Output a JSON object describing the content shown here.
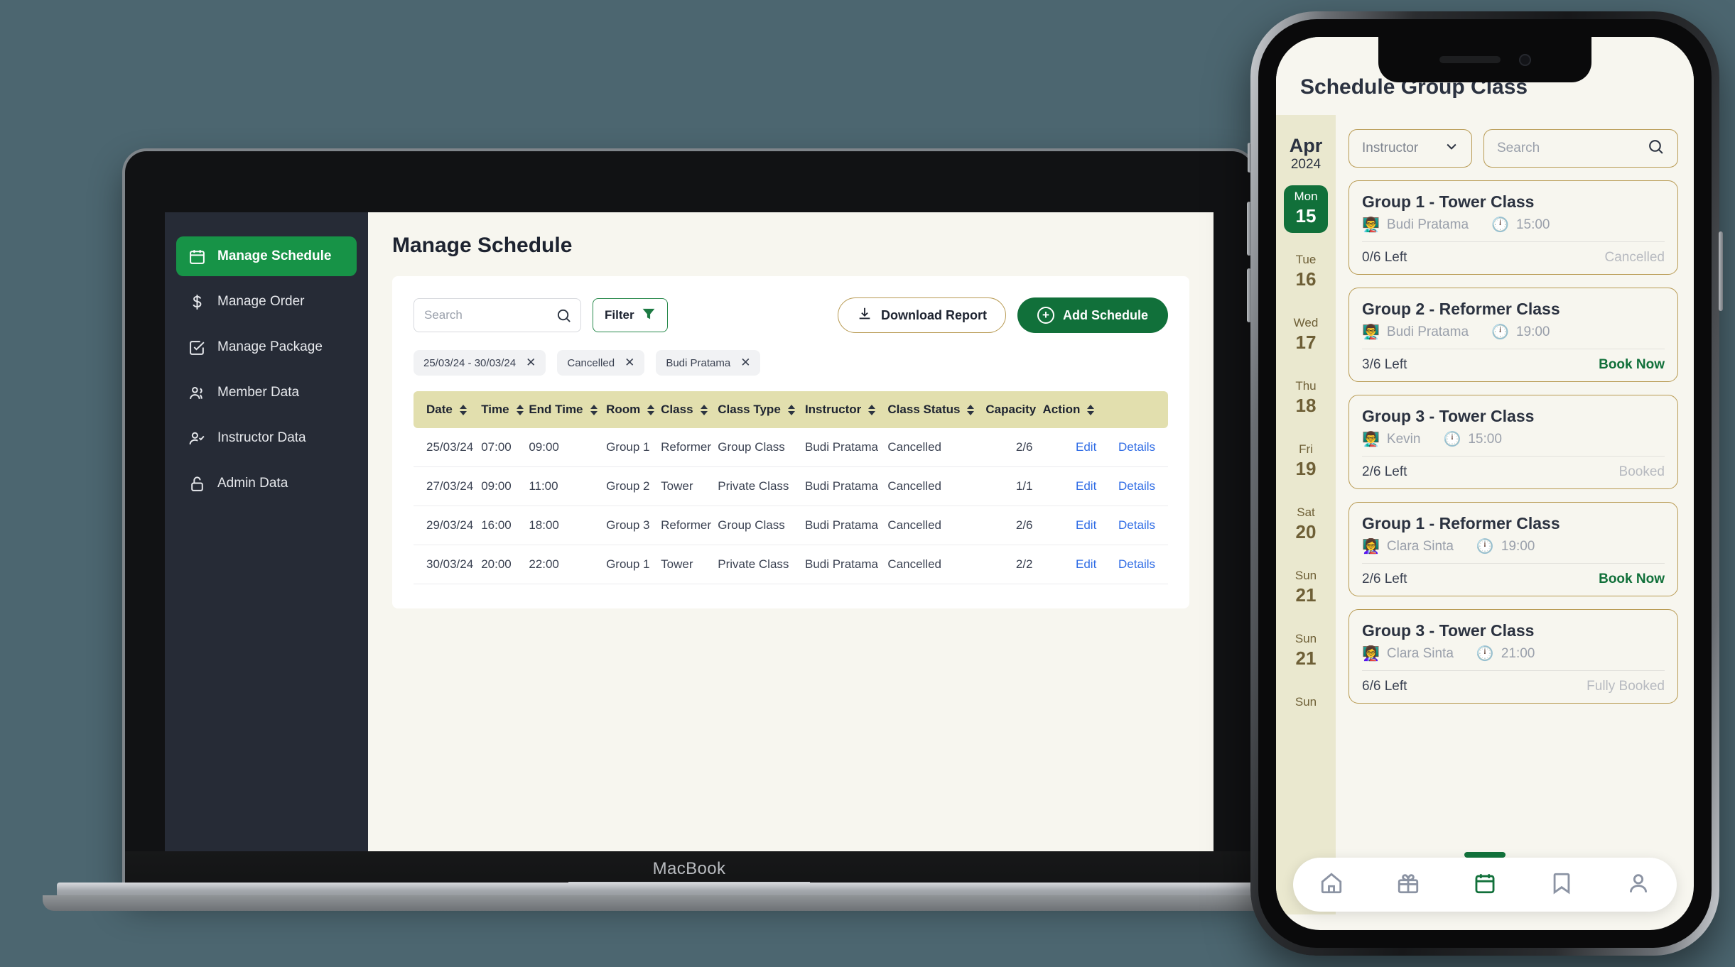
{
  "desktop": {
    "device_label": "MacBook",
    "sidebar": {
      "items": [
        {
          "label": "Manage Schedule",
          "icon": "calendar-icon",
          "active": true
        },
        {
          "label": "Manage Order",
          "icon": "dollar-icon",
          "active": false
        },
        {
          "label": "Manage Package",
          "icon": "checkbox-icon",
          "active": false
        },
        {
          "label": "Member Data",
          "icon": "users-icon",
          "active": false
        },
        {
          "label": "Instructor Data",
          "icon": "user-check-icon",
          "active": false
        },
        {
          "label": "Admin Data",
          "icon": "lock-icon",
          "active": false
        }
      ]
    },
    "page_title": "Manage Schedule",
    "toolbar": {
      "search_placeholder": "Search",
      "filter_label": "Filter",
      "download_label": "Download Report",
      "add_label": "Add Schedule"
    },
    "filter_chips": [
      {
        "label": "25/03/24 - 30/03/24"
      },
      {
        "label": "Cancelled"
      },
      {
        "label": "Budi Pratama"
      }
    ],
    "table": {
      "columns": [
        {
          "label": "Date",
          "sortable": true
        },
        {
          "label": "Time",
          "sortable": true
        },
        {
          "label": "End Time",
          "sortable": true
        },
        {
          "label": "Room",
          "sortable": true
        },
        {
          "label": "Class",
          "sortable": true
        },
        {
          "label": "Class Type",
          "sortable": true
        },
        {
          "label": "Instructor",
          "sortable": true
        },
        {
          "label": "Class Status",
          "sortable": true
        },
        {
          "label": "Capacity",
          "sortable": false
        },
        {
          "label": "Action",
          "sortable": true
        }
      ],
      "rows": [
        {
          "date": "25/03/24",
          "time": "07:00",
          "end_time": "09:00",
          "room": "Group 1",
          "class": "Reformer",
          "class_type": "Group Class",
          "instructor": "Budi Pratama",
          "class_status": "Cancelled",
          "capacity": "2/6",
          "edit": "Edit",
          "details": "Details"
        },
        {
          "date": "27/03/24",
          "time": "09:00",
          "end_time": "11:00",
          "room": "Group 2",
          "class": "Tower",
          "class_type": "Private Class",
          "instructor": "Budi Pratama",
          "class_status": "Cancelled",
          "capacity": "1/1",
          "edit": "Edit",
          "details": "Details"
        },
        {
          "date": "29/03/24",
          "time": "16:00",
          "end_time": "18:00",
          "room": "Group 3",
          "class": "Reformer",
          "class_type": "Group Class",
          "instructor": "Budi Pratama",
          "class_status": "Cancelled",
          "capacity": "2/6",
          "edit": "Edit",
          "details": "Details"
        },
        {
          "date": "30/03/24",
          "time": "20:00",
          "end_time": "22:00",
          "room": "Group 1",
          "class": "Tower",
          "class_type": "Private Class",
          "instructor": "Budi Pratama",
          "class_status": "Cancelled",
          "capacity": "2/2",
          "edit": "Edit",
          "details": "Details"
        }
      ]
    }
  },
  "mobile": {
    "title": "Schedule Group Class",
    "month": "Apr",
    "year": "2024",
    "controls": {
      "instructor_label": "Instructor",
      "search_placeholder": "Search"
    },
    "dates": [
      {
        "weekday": "Mon",
        "day": "15",
        "selected": true
      },
      {
        "weekday": "Tue",
        "day": "16",
        "selected": false
      },
      {
        "weekday": "Wed",
        "day": "17",
        "selected": false
      },
      {
        "weekday": "Thu",
        "day": "18",
        "selected": false
      },
      {
        "weekday": "Fri",
        "day": "19",
        "selected": false
      },
      {
        "weekday": "Sat",
        "day": "20",
        "selected": false
      },
      {
        "weekday": "Sun",
        "day": "21",
        "selected": false
      },
      {
        "weekday": "Sun",
        "day": "21",
        "selected": false
      },
      {
        "weekday": "Sun",
        "day": "",
        "selected": false
      }
    ],
    "classes": [
      {
        "title": "Group 1 - Tower Class",
        "instructor": "Budi Pratama",
        "avatar": "male-teacher-emoji",
        "time": "15:00",
        "slots": "0/6 Left",
        "status": "Cancelled",
        "status_kind": "grey"
      },
      {
        "title": "Group 2 - Reformer Class",
        "instructor": "Budi Pratama",
        "avatar": "male-teacher-emoji",
        "time": "19:00",
        "slots": "3/6 Left",
        "status": "Book Now",
        "status_kind": "book"
      },
      {
        "title": "Group 3 - Tower Class",
        "instructor": "Kevin",
        "avatar": "male-teacher-emoji",
        "time": "15:00",
        "slots": "2/6 Left",
        "status": "Booked",
        "status_kind": "grey"
      },
      {
        "title": "Group 1 - Reformer Class",
        "instructor": "Clara Sinta",
        "avatar": "female-teacher-emoji",
        "time": "19:00",
        "slots": "2/6 Left",
        "status": "Book Now",
        "status_kind": "book"
      },
      {
        "title": "Group 3 - Tower Class",
        "instructor": "Clara Sinta",
        "avatar": "female-teacher-emoji",
        "time": "21:00",
        "slots": "6/6 Left",
        "status": "Fully Booked",
        "status_kind": "grey"
      }
    ],
    "bottom_nav": [
      {
        "icon": "home-icon",
        "active": false
      },
      {
        "icon": "gift-icon",
        "active": false
      },
      {
        "icon": "calendar-icon",
        "active": true
      },
      {
        "icon": "bookmark-icon",
        "active": false
      },
      {
        "icon": "person-icon",
        "active": false
      }
    ]
  },
  "colors": {
    "background": "#4c6670",
    "brand_green": "#11703a",
    "accent_green": "#179347",
    "gold": "#b89a52",
    "table_header": "#e2dfae",
    "link_blue": "#2f6ce5"
  }
}
